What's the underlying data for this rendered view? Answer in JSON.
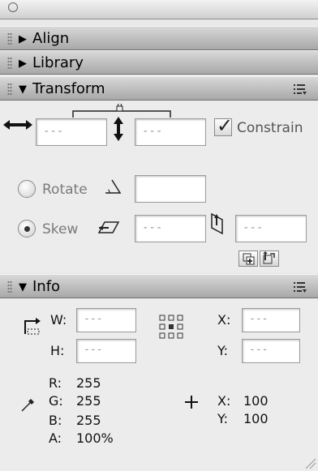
{
  "panels": {
    "align": {
      "title": "Align"
    },
    "library": {
      "title": "Library"
    },
    "transform": {
      "title": "Transform",
      "width_value": "---",
      "height_value": "---",
      "constrain_label": "Constrain",
      "rotate_label": "Rotate",
      "skew_label": "Skew",
      "skew_h_value": "---",
      "skew_v_value": "---"
    },
    "info": {
      "title": "Info",
      "w_label": "W:",
      "h_label": "H:",
      "w_value": "---",
      "h_value": "---",
      "x_label": "X:",
      "y_label": "Y:",
      "x_value": "---",
      "y_value": "---",
      "r_label": "R:",
      "g_label": "G:",
      "b_label": "B:",
      "a_label": "A:",
      "r_value": "255",
      "g_value": "255",
      "b_value": "255",
      "a_value": "100%",
      "cursor_x_label": "X:",
      "cursor_y_label": "Y:",
      "cursor_x_value": "100",
      "cursor_y_value": "100"
    }
  },
  "state": {
    "align_expanded": false,
    "library_expanded": false,
    "transform_expanded": true,
    "info_expanded": true,
    "constrain_checked": true,
    "rotate_selected": false,
    "skew_selected": true
  },
  "icons": {
    "expand": "triangle-right",
    "collapse": "triangle-down",
    "panel_menu": "options-menu-icon",
    "copy_transform": "copy-and-apply-transform-icon",
    "reset": "reset-transform-icon"
  },
  "colors": {
    "panel_body": "#ececec",
    "header_top": "#d8d8d8",
    "header_bottom": "#a8a8a8",
    "field_text": "#999999"
  }
}
